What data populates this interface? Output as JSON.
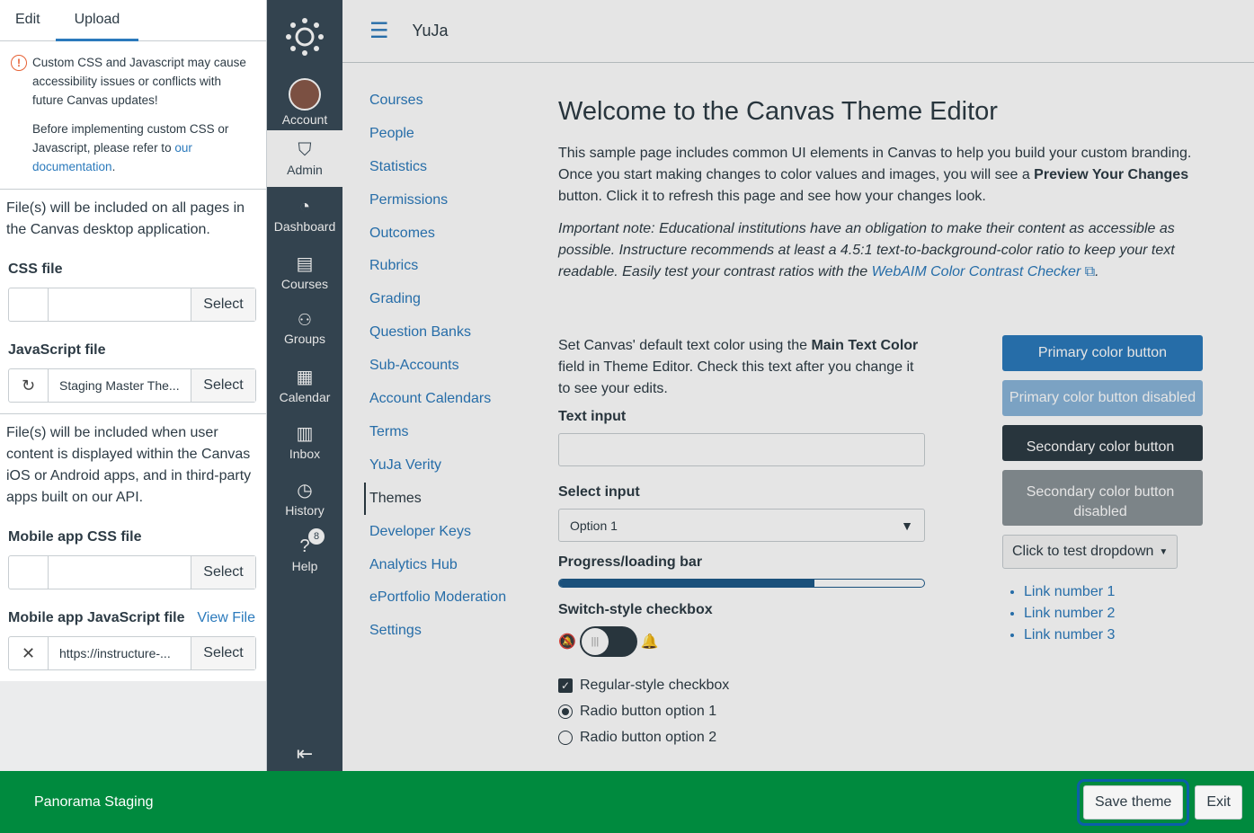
{
  "left_panel": {
    "tabs": [
      "Edit",
      "Upload"
    ],
    "warning": {
      "line1": "Custom CSS and Javascript may cause accessibility issues or conflicts with future Canvas updates!",
      "line2_prefix": "Before implementing custom CSS or Javascript, please refer to ",
      "line2_link": "our documentation",
      "line2_suffix": "."
    },
    "desktop_note": "File(s) will be included on all pages in the Canvas desktop application.",
    "css_file": {
      "label": "CSS file",
      "value": "",
      "select": "Select"
    },
    "js_file": {
      "label": "JavaScript file",
      "value": "Staging Master The...",
      "select": "Select"
    },
    "mobile_note": "File(s) will be included when user content is displayed within the Canvas iOS or Android apps, and in third-party apps built on our API.",
    "mobile_css": {
      "label": "Mobile app CSS file",
      "value": "",
      "select": "Select"
    },
    "mobile_js": {
      "label": "Mobile app JavaScript file",
      "view": "View File",
      "value": "https://instructure-...",
      "select": "Select"
    }
  },
  "global_nav": {
    "items": [
      {
        "label": "Account",
        "icon": "avatar"
      },
      {
        "label": "Admin",
        "icon": "shield-icon"
      },
      {
        "label": "Dashboard",
        "icon": "dashboard-icon"
      },
      {
        "label": "Courses",
        "icon": "book-icon"
      },
      {
        "label": "Groups",
        "icon": "groups-icon"
      },
      {
        "label": "Calendar",
        "icon": "calendar-icon"
      },
      {
        "label": "Inbox",
        "icon": "inbox-icon"
      },
      {
        "label": "History",
        "icon": "clock-icon"
      },
      {
        "label": "Help",
        "icon": "help-icon",
        "badge": "8"
      }
    ]
  },
  "header": {
    "breadcrumb": "YuJa"
  },
  "course_nav": [
    "Courses",
    "People",
    "Statistics",
    "Permissions",
    "Outcomes",
    "Rubrics",
    "Grading",
    "Question Banks",
    "Sub-Accounts",
    "Account Calendars",
    "Terms",
    "YuJa Verity",
    "Themes",
    "Developer Keys",
    "Analytics Hub",
    "ePortfolio Moderation",
    "Settings"
  ],
  "content": {
    "title": "Welcome to the Canvas Theme Editor",
    "intro_a": "This sample page includes common UI elements in Canvas to help you build your custom branding. Once you start making changes to color values and images, you will see a ",
    "intro_b": "Preview Your Changes",
    "intro_c": " button. Click it to refresh this page and see how your changes look.",
    "note_a": "Important note: Educational institutions have an obligation to make their content as accessible as possible. Instructure recommends at least a 4.5:1 text-to-background-color ratio to keep your text readable. Easily test your contrast ratios with the ",
    "note_link": "WebAIM Color Contrast Checker",
    "note_c": ".",
    "main_text_a": "Set Canvas' default text color using the ",
    "main_text_b": "Main Text Color",
    "main_text_c": " field in Theme Editor. Check this text after you change it to see your edits.",
    "text_input_label": "Text input",
    "select_label": "Select input",
    "select_value": "Option 1",
    "progress_label": "Progress/loading bar",
    "progress_value": 0.7,
    "switch_label": "Switch-style checkbox",
    "checkbox_label": "Regular-style checkbox",
    "radio1": "Radio button option 1",
    "radio2": "Radio button option 2",
    "buttons": {
      "primary": "Primary color button",
      "primary_disabled": "Primary color button disabled",
      "secondary": "Secondary color button",
      "secondary_disabled": "Secondary color button disabled",
      "dropdown": "Click to test dropdown"
    },
    "links": [
      "Link number 1",
      "Link number 2",
      "Link number 3"
    ]
  },
  "footer": {
    "env": "Panorama Staging",
    "save": "Save theme",
    "exit": "Exit"
  }
}
